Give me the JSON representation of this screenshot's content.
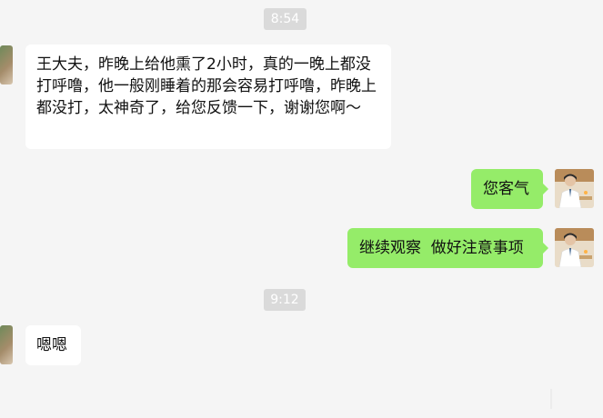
{
  "chat": {
    "timestamps": [
      "8:54",
      "9:12"
    ],
    "messages": [
      {
        "side": "left",
        "text": "王大夫，昨晚上给他熏了2小时，真的一晚上都没打呼噜，他一般刚睡着的那会容易打呼噜，昨晚上都没打，太神奇了，给您反馈一下，谢谢您啊～"
      },
      {
        "side": "right",
        "text": "您客气"
      },
      {
        "side": "right",
        "text": "继续观察  做好注意事项"
      },
      {
        "side": "left",
        "text": "嗯嗯"
      }
    ]
  },
  "colors": {
    "background": "#f5f5f5",
    "bubble_self": "#95ec69",
    "bubble_other": "#ffffff",
    "timestamp_bg": "#dadada"
  },
  "icons": {
    "left_avatar": "contact-avatar-icon",
    "right_avatar": "doctor-avatar-icon"
  }
}
